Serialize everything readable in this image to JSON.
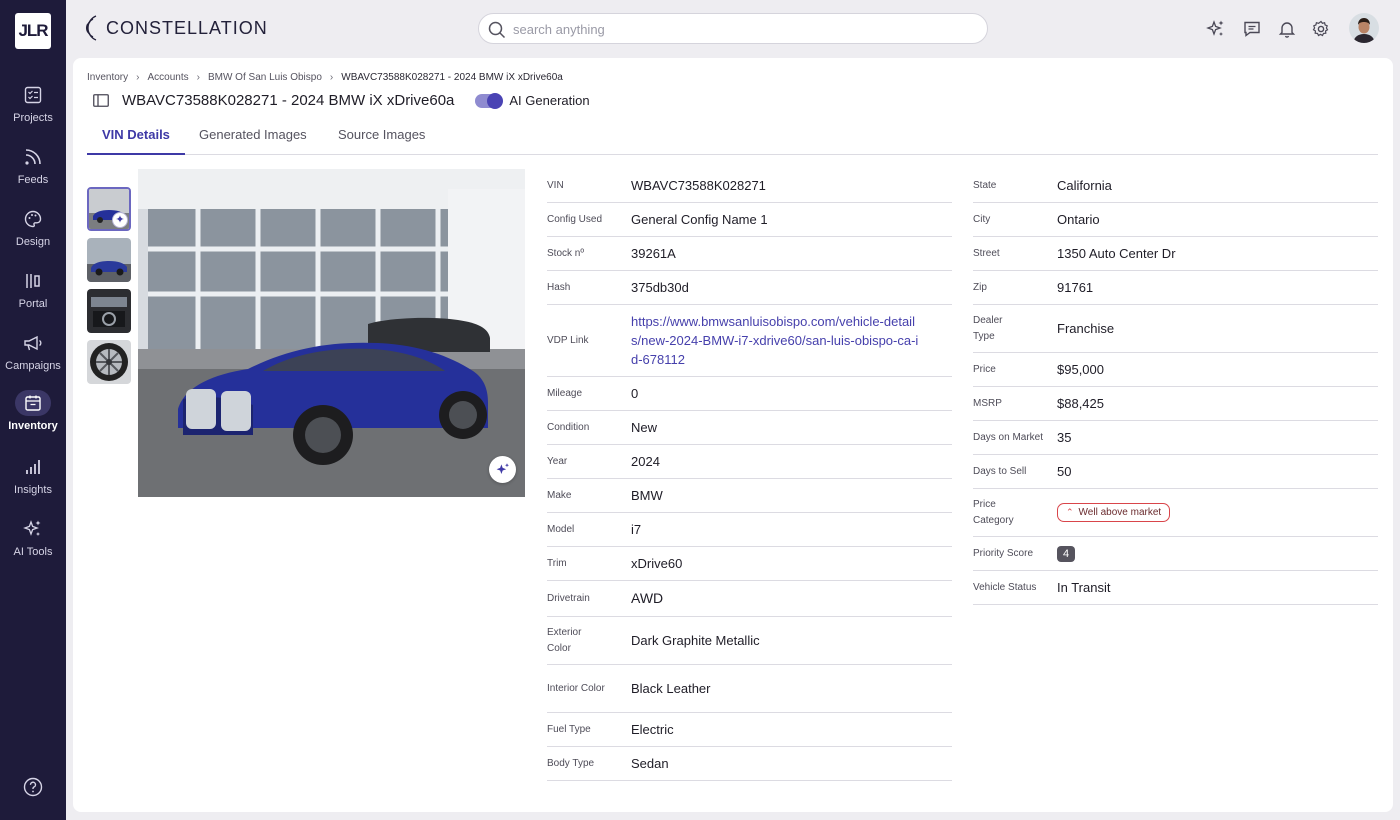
{
  "sidebar": {
    "logo": "JLR",
    "items": [
      {
        "label": "Projects",
        "icon": "projects-icon"
      },
      {
        "label": "Feeds",
        "icon": "feeds-icon"
      },
      {
        "label": "Design",
        "icon": "palette-icon"
      },
      {
        "label": "Portal",
        "icon": "portal-icon"
      },
      {
        "label": "Campaigns",
        "icon": "megaphone-icon"
      },
      {
        "label": "Inventory",
        "icon": "inventory-icon",
        "active": true
      },
      {
        "label": "Insights",
        "icon": "bar-chart-icon"
      },
      {
        "label": "AI Tools",
        "icon": "sparkle-icon"
      }
    ],
    "help_icon": "help-icon"
  },
  "header": {
    "brand": "CONSTELLATION",
    "search_placeholder": "search anything",
    "icons": [
      "ai-sparkle-icon",
      "chat-icon",
      "bell-icon",
      "gear-icon"
    ]
  },
  "breadcrumb": [
    "Inventory",
    "Accounts",
    "BMW Of San Luis Obispo",
    "WBAVC73588K028271 - 2024 BMW iX xDrive60a"
  ],
  "page": {
    "title": "WBAVC73588K028271 - 2024 BMW iX xDrive60a",
    "ai_generation_label": "AI Generation",
    "ai_generation_on": true
  },
  "tabs": [
    {
      "label": "VIN Details",
      "active": true
    },
    {
      "label": "Generated Images"
    },
    {
      "label": "Source Images"
    }
  ],
  "details_left": [
    {
      "key": "VIN",
      "value": "WBAVC73588K028271"
    },
    {
      "key": "Config Used",
      "value": "General Config Name 1"
    },
    {
      "key": "Stock nº",
      "value": "39261A"
    },
    {
      "key": "Hash",
      "value": "375db30d"
    },
    {
      "key": "VDP Link",
      "value": "https://www.bmwsanluisobispo.com/vehicle-details/new-2024-BMW-i7-xdrive60/san-luis-obispo-ca-id-678112"
    },
    {
      "key": "Mileage",
      "value": "0"
    },
    {
      "key": "Condition",
      "value": "New"
    },
    {
      "key": "Year",
      "value": "2024"
    },
    {
      "key": "Make",
      "value": "BMW"
    },
    {
      "key": "Model",
      "value": "i7"
    },
    {
      "key": "Trim",
      "value": "xDrive60"
    },
    {
      "key": "Drivetrain",
      "value": "AWD"
    },
    {
      "key": "Exterior Color",
      "value": "Dark Graphite Metallic"
    },
    {
      "key": "Interior Color",
      "value": "Black Leather"
    },
    {
      "key": "Fuel Type",
      "value": "Electric"
    },
    {
      "key": "Body Type",
      "value": "Sedan"
    }
  ],
  "details_right": [
    {
      "key": "State",
      "value": "California"
    },
    {
      "key": "City",
      "value": "Ontario"
    },
    {
      "key": "Street",
      "value": "1350 Auto Center Dr"
    },
    {
      "key": "Zip",
      "value": "91761"
    },
    {
      "key": "Dealer Type",
      "value": "Franchise"
    },
    {
      "key": "Price",
      "value": "$95,000"
    },
    {
      "key": "MSRP",
      "value": "$88,425"
    },
    {
      "key": "Days on Market",
      "value": "35"
    },
    {
      "key": "Days to Sell",
      "value": "50"
    },
    {
      "key": "Price Category",
      "value": "Well above market"
    },
    {
      "key": "Priority Score",
      "value": "4"
    },
    {
      "key": "Vehicle Status",
      "value": "In Transit"
    }
  ],
  "colors": {
    "sidebar_bg": "#1e1b3a",
    "accent": "#3e39a6",
    "link": "#4640ac",
    "car_blue": "#25309a",
    "price_chip_border": "#d9454a"
  }
}
